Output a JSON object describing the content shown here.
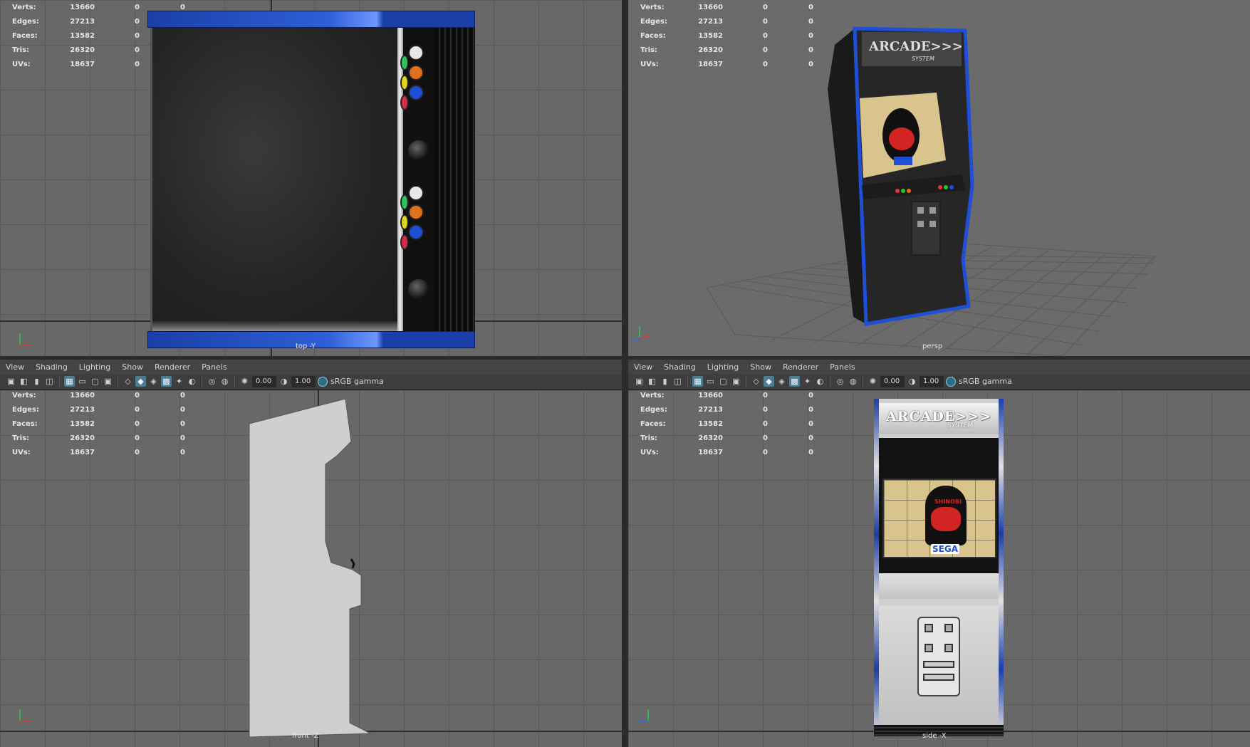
{
  "hud": {
    "rows": [
      {
        "label": "Verts:",
        "v1": "13660",
        "v2": "0",
        "v3": "0"
      },
      {
        "label": "Edges:",
        "v1": "27213",
        "v2": "0",
        "v3": "0"
      },
      {
        "label": "Faces:",
        "v1": "13582",
        "v2": "0",
        "v3": "0"
      },
      {
        "label": "Tris:",
        "v1": "26320",
        "v2": "0",
        "v3": "0"
      },
      {
        "label": "UVs:",
        "v1": "18637",
        "v2": "0",
        "v3": "0"
      }
    ]
  },
  "menubar": {
    "items": [
      "View",
      "Shading",
      "Lighting",
      "Show",
      "Renderer",
      "Panels"
    ]
  },
  "toolbar": {
    "exposure": "0.00",
    "gamma": "1.00",
    "colorspace": "sRGB gamma"
  },
  "viewports": {
    "top_label": "top -Y",
    "persp_label": "persp",
    "front_label": "front -Z",
    "side_label": "side -X"
  },
  "cabinet": {
    "marquee_main": "ARCADE>>>",
    "marquee_sub": "SYSTEM",
    "screen_title": "SHINOBI",
    "screen_brand": "SEGA"
  },
  "colors": {
    "viewport_bg": "#686868",
    "accent_blue": "#1b3fa8",
    "toolbar_active": "#4f7d8f"
  }
}
